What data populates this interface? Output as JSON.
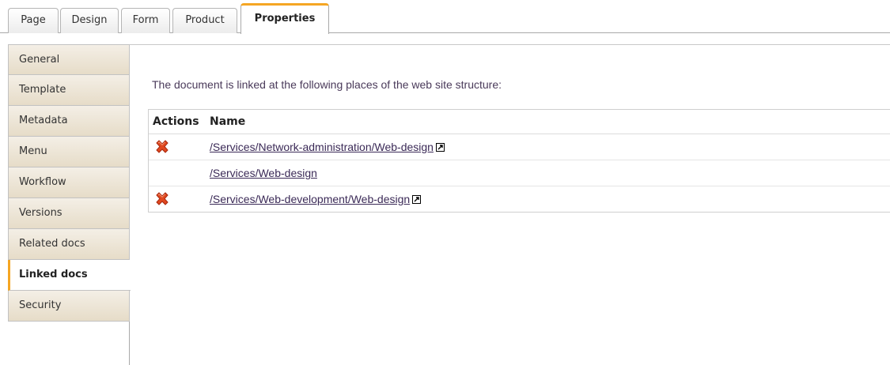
{
  "tabs": [
    {
      "label": "Page"
    },
    {
      "label": "Design"
    },
    {
      "label": "Form"
    },
    {
      "label": "Product"
    },
    {
      "label": "Properties",
      "active": true
    }
  ],
  "sidebar": {
    "items": [
      {
        "label": "General"
      },
      {
        "label": "Template"
      },
      {
        "label": "Metadata"
      },
      {
        "label": "Menu"
      },
      {
        "label": "Workflow"
      },
      {
        "label": "Versions"
      },
      {
        "label": "Related docs"
      },
      {
        "label": "Linked docs",
        "active": true
      },
      {
        "label": "Security"
      }
    ]
  },
  "main": {
    "intro": "The document is linked at the following places of the web site structure:",
    "table": {
      "headers": {
        "actions": "Actions",
        "name": "Name"
      },
      "rows": [
        {
          "name": "/Services/Network-administration/Web-design",
          "deletable": true,
          "external_icon": "external-link-icon"
        },
        {
          "name": "/Services/Web-design",
          "deletable": false
        },
        {
          "name": "/Services/Web-development/Web-design",
          "deletable": true,
          "external_icon": "external-link-icon"
        }
      ]
    }
  },
  "icons": {
    "delete": "delete-x-icon",
    "external": "external-link-icon"
  },
  "colors": {
    "accent": "#f5a623",
    "sidebar_bg": "#e6dcc8",
    "delete_red": "#d9381e",
    "link": "#3b2a57"
  }
}
